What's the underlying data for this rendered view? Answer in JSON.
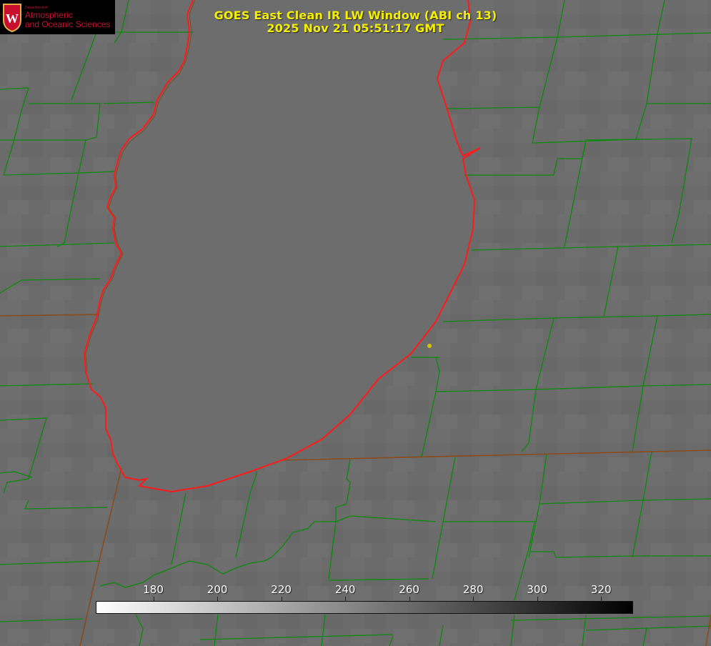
{
  "title_line1": "GOES East Clean IR LW Window (ABI ch 13)",
  "title_line2": "2025 Nov 21 05:51:17 GMT",
  "logo": {
    "dept": "Department of",
    "line1": "Atmospheric",
    "line2": "and Oceanic Sciences",
    "crest_letter": "W"
  },
  "colorbar": {
    "ticks": [
      "180",
      "200",
      "220",
      "240",
      "260",
      "280",
      "300",
      "320"
    ],
    "min": 162,
    "max": 330,
    "gradient_start": "#ffffff",
    "gradient_end": "#000000"
  },
  "colors": {
    "boundary_green": "#0a8a0a",
    "shoreline_red": "#ff1a1a",
    "title_yellow": "#f4f000",
    "marker_yellow": "#d4c400"
  }
}
